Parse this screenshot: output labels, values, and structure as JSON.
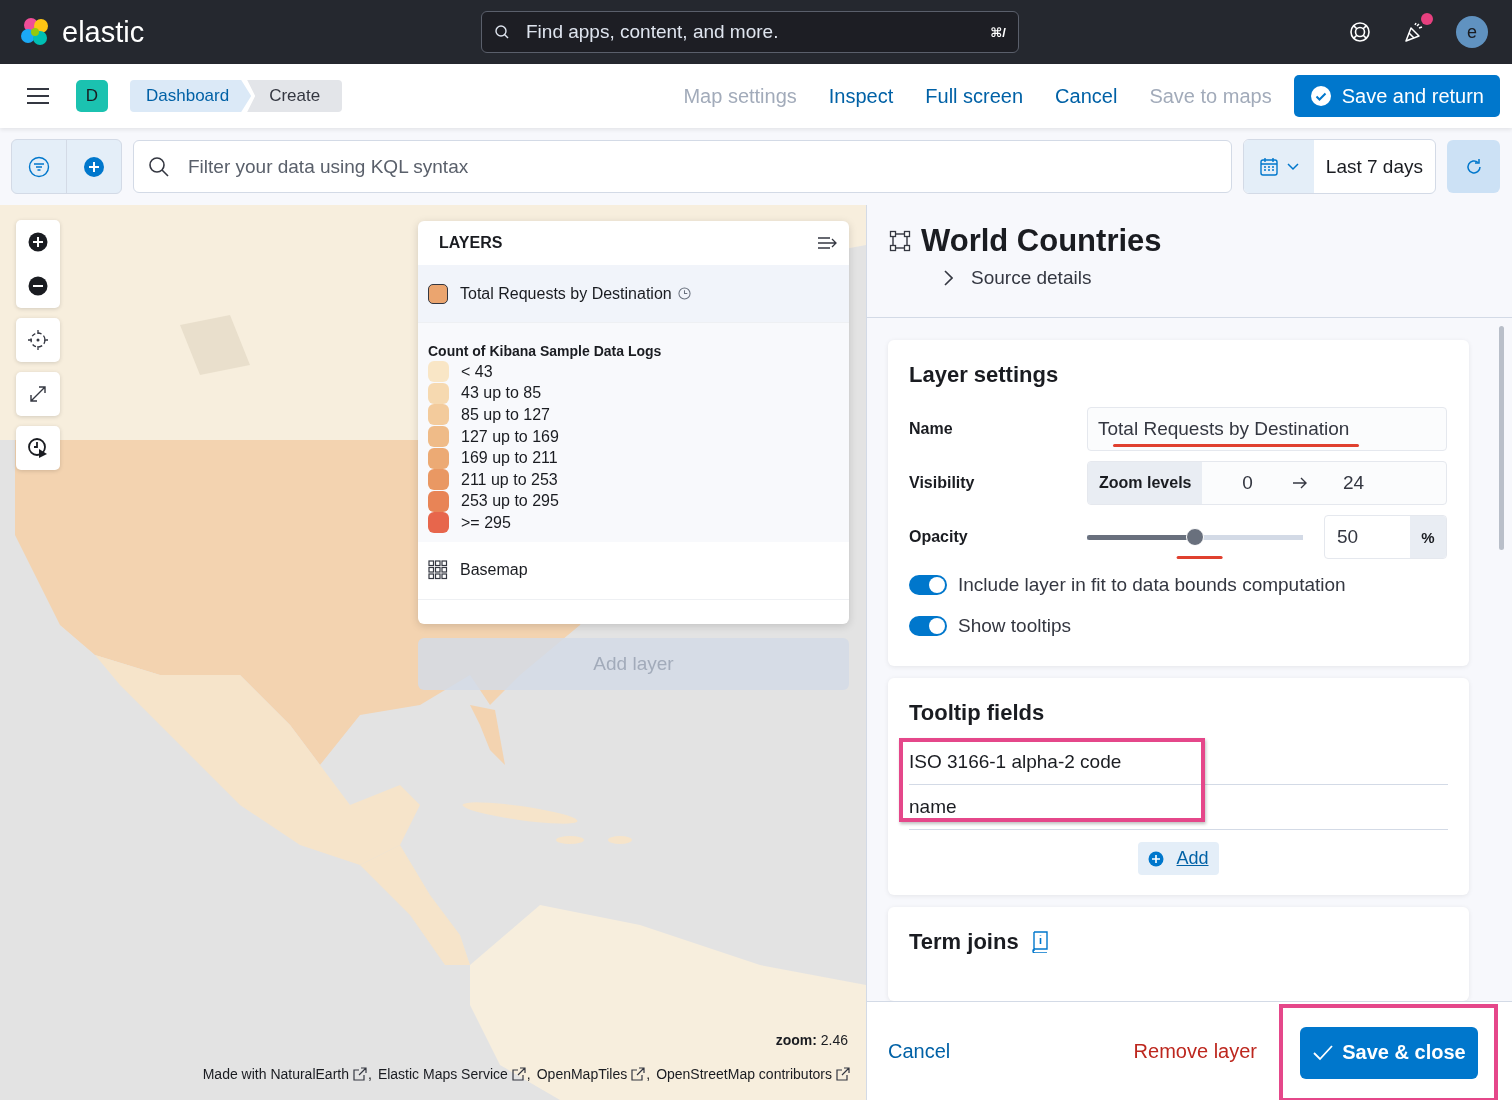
{
  "header": {
    "logo": "elastic",
    "search": {
      "placeholder": "Find apps, content, and more.",
      "shortcut": "⌘/"
    },
    "notification": true,
    "avatar": "e"
  },
  "app_bar": {
    "space": "D",
    "breadcrumbs": [
      {
        "label": "Dashboard",
        "selected": false
      },
      {
        "label": "Create",
        "selected": true
      }
    ],
    "actions": [
      {
        "label": "Map settings",
        "disabled": true
      },
      {
        "label": "Inspect",
        "disabled": false
      },
      {
        "label": "Full screen",
        "disabled": false
      },
      {
        "label": "Cancel",
        "disabled": false
      },
      {
        "label": "Save to maps",
        "disabled": true
      }
    ],
    "primary": "Save and return"
  },
  "query_bar": {
    "placeholder": "Filter your data using KQL syntax",
    "time_range": "Last 7 days"
  },
  "map": {
    "layers_panel": {
      "title": "LAYERS",
      "layers": [
        {
          "name": "Total Requests by Destination",
          "kind": "choropleth",
          "color": "#eba56f",
          "selected": true,
          "legend": {
            "title": "Count of Kibana Sample Data Logs",
            "items": [
              {
                "label": "< 43",
                "color": "#f9e6c6"
              },
              {
                "label": "43 up to 85",
                "color": "#f6d9b0"
              },
              {
                "label": "85 up to 127",
                "color": "#f3cb9c"
              },
              {
                "label": "127 up to 169",
                "color": "#efbb88"
              },
              {
                "label": "169 up to 211",
                "color": "#ecaa74"
              },
              {
                "label": "211 up to 253",
                "color": "#e99863"
              },
              {
                "label": "253 up to 295",
                "color": "#e88456"
              },
              {
                "label": ">= 295",
                "color": "#e7664c"
              }
            ]
          }
        },
        {
          "name": "Basemap",
          "kind": "tiles",
          "selected": false
        }
      ]
    },
    "add_layer": "Add layer",
    "zoom_label": "zoom:",
    "zoom_value": "2.46",
    "attribution": [
      {
        "label": "Made with NaturalEarth",
        "separator": ","
      },
      {
        "label": "Elastic Maps Service",
        "separator": ","
      },
      {
        "label": "OpenMapTiles",
        "separator": ","
      },
      {
        "label": "OpenStreetMap contributors"
      }
    ]
  },
  "editor": {
    "title": "World Countries",
    "source_details": "Source details",
    "layer_settings": {
      "title": "Layer settings",
      "name_label": "Name",
      "name_value": "Total Requests by Destination",
      "visibility_label": "Visibility",
      "zoom_prepend": "Zoom levels",
      "zoom_min": "0",
      "zoom_max": "24",
      "opacity_label": "Opacity",
      "opacity": {
        "level": 0.5,
        "value": "50",
        "unit": "%"
      },
      "switches": [
        {
          "label": "Include layer in fit to data bounds computation",
          "on": true
        },
        {
          "label": "Show tooltips",
          "on": true
        }
      ]
    },
    "tooltip_fields": {
      "title": "Tooltip fields",
      "fields": [
        "ISO 3166-1 alpha-2 code",
        "name"
      ],
      "add": "Add"
    },
    "term_joins": {
      "title": "Term joins"
    },
    "footer": {
      "cancel": "Cancel",
      "remove": "Remove layer",
      "save": "Save & close"
    }
  }
}
